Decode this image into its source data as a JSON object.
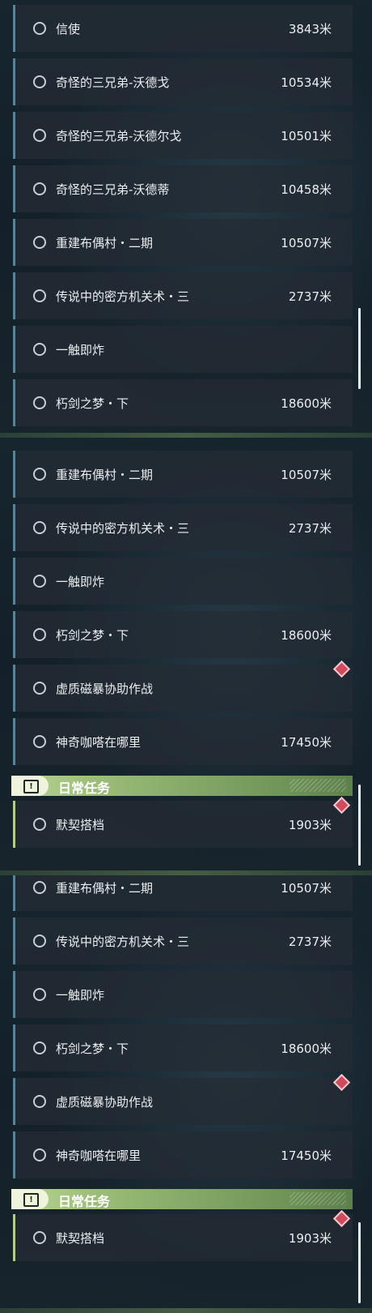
{
  "panel1": {
    "quests": [
      {
        "name": "信使",
        "distance": "3843米"
      },
      {
        "name": "奇怪的三兄弟-沃德戈",
        "distance": "10534米"
      },
      {
        "name": "奇怪的三兄弟-沃德尔戈",
        "distance": "10501米"
      },
      {
        "name": "奇怪的三兄弟-沃德蒂",
        "distance": "10458米"
      },
      {
        "name": "重建布偶村・二期",
        "distance": "10507米"
      },
      {
        "name": "传说中的密方机关术・三",
        "distance": "2737米"
      },
      {
        "name": "一触即炸",
        "distance": ""
      },
      {
        "name": "朽剑之梦・下",
        "distance": "18600米"
      }
    ]
  },
  "panel2": {
    "quests": [
      {
        "name": "重建布偶村・二期",
        "distance": "10507米"
      },
      {
        "name": "传说中的密方机关术・三",
        "distance": "2737米"
      },
      {
        "name": "一触即炸",
        "distance": ""
      },
      {
        "name": "朽剑之梦・下",
        "distance": "18600米"
      },
      {
        "name": "虚质磁暴协助作战",
        "distance": ""
      },
      {
        "name": "神奇咖嗒在哪里",
        "distance": "17450米"
      }
    ],
    "section_title": "日常任务",
    "daily": {
      "name": "默契搭档",
      "distance": "1903米"
    }
  },
  "panel3": {
    "quests": [
      {
        "name": "重建布偶村・二期",
        "distance": "10507米"
      },
      {
        "name": "传说中的密方机关术・三",
        "distance": "2737米"
      },
      {
        "name": "一触即炸",
        "distance": ""
      },
      {
        "name": "朽剑之梦・下",
        "distance": "18600米"
      },
      {
        "name": "虚质磁暴协助作战",
        "distance": ""
      },
      {
        "name": "神奇咖嗒在哪里",
        "distance": "17450米"
      }
    ],
    "section_title": "日常任务",
    "daily": {
      "name": "默契搭档",
      "distance": "1903米"
    }
  },
  "icons": {
    "quest_status": "circle-icon",
    "section": "exclamation-icon",
    "tracked": "diamond-marker-icon"
  },
  "colors": {
    "accent_blue": "#5a8495",
    "daily_green": "#9bbd78",
    "marker_red": "#d04a5c"
  }
}
